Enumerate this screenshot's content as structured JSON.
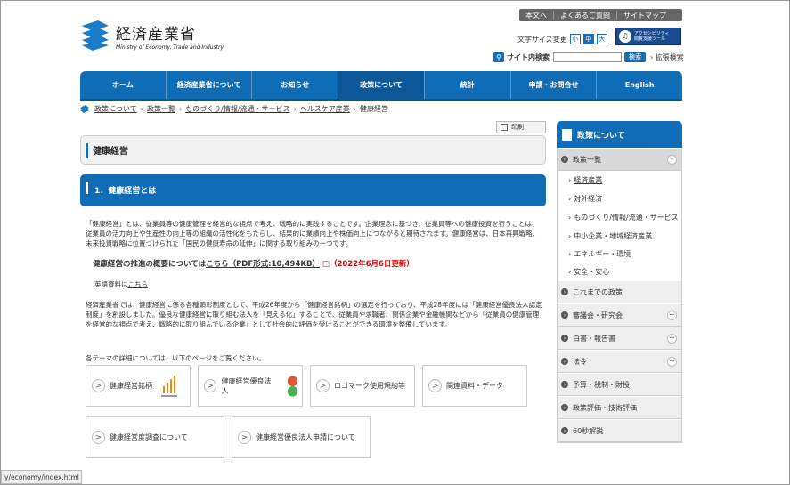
{
  "toplinks": {
    "text_skip": "本文へ",
    "faq": "よくあるご質問",
    "sitemap": "サイトマップ"
  },
  "logo": {
    "jp": "経済産業省",
    "en": "Ministry of Economy, Trade and Industry"
  },
  "fontsize": {
    "label": "文字サイズ変更",
    "small": "小",
    "medium": "中",
    "large": "大"
  },
  "access": {
    "line1": "アクセシビリティ",
    "line2": "閲覧支援ツール"
  },
  "search": {
    "label": "サイト内検索",
    "button": "検索",
    "advanced": "拡張検索"
  },
  "nav": {
    "items": [
      "ホーム",
      "経済産業省について",
      "お知らせ",
      "政策について",
      "統計",
      "申請・お問合せ",
      "English"
    ]
  },
  "breadcrumb": {
    "items": [
      "政策について",
      "政策一覧",
      "ものづくり/情報/流通・サービス",
      "ヘルスケア産業",
      "健康経営"
    ]
  },
  "print": "印刷",
  "page_title": "健康経営",
  "section1": "1．健康経営とは",
  "p1": "「健康経営」とは、従業員等の健康管理を経営的な視点で考え、戦略的に実践することです。企業理念に基づき、従業員等への健康投資を行うことは、従業員の活力向上や生産性の向上等の組織の活性化をもたらし、結果的に業績向上や株価向上につながると期待されます。健康経営は、日本再興戦略、未来投資戦略に位置づけられた「国民の健康寿命の延伸」に関する取り組みの一つです。",
  "p2": {
    "text": "健康経営の推進の概要については",
    "link": "こちら（PDF形式:10,494KB）",
    "updated": "（2022年6月6日更新）"
  },
  "p3": {
    "text": "英語資料は",
    "link": "こちら"
  },
  "p4": "経済産業省では、健康経営に係る各種顕彰制度として、平成26年度から「健康経営銘柄」の選定を行っており、平成28年度には「健康経営優良法人認定制度」を創設しました。優良な健康経営に取り組む法人を「見える化」することで、従業員や求職者、関係企業や金融機関などから「従業員の健康管理を経営的な視点で考え、戦略的に取り組んでいる企業」として社会的に評価を受けることができる環境を整備しています。",
  "p5": "各テーマの詳細については、以下のページをご覧ください。",
  "cards": [
    "健康経営銘柄",
    "健康経営優良法人",
    "ロゴマーク使用規約等",
    "関連資料・データ",
    "健康経営度調査について",
    "健康経営優良法人申請について"
  ],
  "sidebar": {
    "title": "政策について",
    "policy_list": "政策一覧",
    "sub": [
      "経済産業",
      "対外経済",
      "ものづくり/情報/流通・サービス",
      "中小企業・地域経済産業",
      "エネルギー・環境",
      "安全・安心"
    ],
    "items": [
      "これまでの政策",
      "審議会・研究会",
      "白書・報告書",
      "法令",
      "予算・税制・財投",
      "政策評価・技術評価",
      "60秒解説"
    ]
  },
  "status_url": "y/economy/index.html"
}
